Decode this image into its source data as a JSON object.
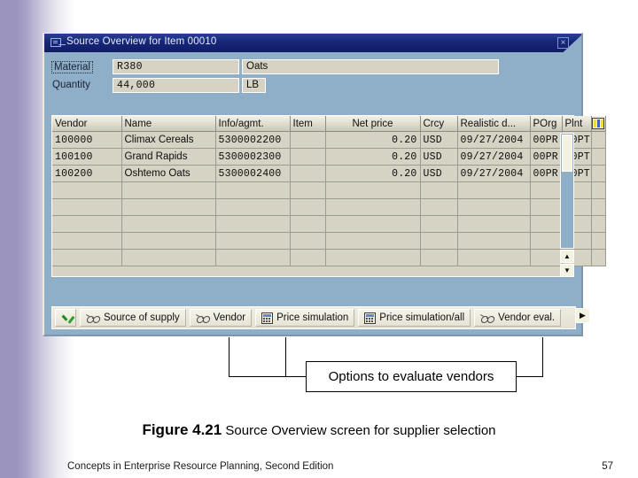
{
  "window": {
    "title": "Source Overview for Item 00010",
    "title_icon": "window-icon",
    "close_icon": "×"
  },
  "form": {
    "material_label": "Material",
    "material_value": "R380",
    "material_description": "Oats",
    "quantity_label": "Quantity",
    "quantity_value": "44,000",
    "quantity_unit": "LB"
  },
  "table": {
    "columns": [
      "Vendor",
      "Name",
      "Info/agmt.",
      "Item",
      "Net price",
      "Crcy",
      "Realistic d...",
      "POrg",
      "Plnt"
    ],
    "config_icon": "table-config-icon",
    "rows": [
      {
        "vendor": "100000",
        "name": "Climax Cereals",
        "info_agmt": "5300002200",
        "item": "",
        "net_price": "0.20",
        "crcy": "USD",
        "realistic_date": "09/27/2004",
        "porg": "00PR",
        "plnt": "00PT"
      },
      {
        "vendor": "100100",
        "name": "Grand Rapids",
        "info_agmt": "5300002300",
        "item": "",
        "net_price": "0.20",
        "crcy": "USD",
        "realistic_date": "09/27/2004",
        "porg": "00PR",
        "plnt": "00PT"
      },
      {
        "vendor": "100200",
        "name": "Oshtemo Oats",
        "info_agmt": "5300002400",
        "item": "",
        "net_price": "0.20",
        "crcy": "USD",
        "realistic_date": "09/27/2004",
        "porg": "00PR",
        "plnt": "00PT"
      }
    ],
    "empty_row_count": 5
  },
  "scrollbars": {
    "vertical_up": "▲",
    "vertical_down": "▼",
    "horizontal_left": "◀",
    "horizontal_right": "▶"
  },
  "buttons": [
    {
      "label": "",
      "icon": "green-check-icon",
      "name": "confirm-button"
    },
    {
      "label": "Source of supply",
      "icon": "glasses-icon",
      "name": "source-of-supply-button"
    },
    {
      "label": "Vendor",
      "icon": "glasses-icon",
      "name": "vendor-button"
    },
    {
      "label": "Price simulation",
      "icon": "calculator-icon",
      "name": "price-simulation-button"
    },
    {
      "label": "Price simulation/all",
      "icon": "calculator-icon",
      "name": "price-simulation-all-button"
    },
    {
      "label": "Vendor eval.",
      "icon": "glasses-icon",
      "name": "vendor-eval-button"
    }
  ],
  "annotation": {
    "callout_text": "Options to evaluate vendors"
  },
  "caption": {
    "figure_number": "Figure 4.21",
    "figure_text": "Source Overview screen for supplier selection"
  },
  "footer": {
    "book_title": "Concepts in Enterprise Resource Planning, Second Edition",
    "page_number": "57"
  }
}
